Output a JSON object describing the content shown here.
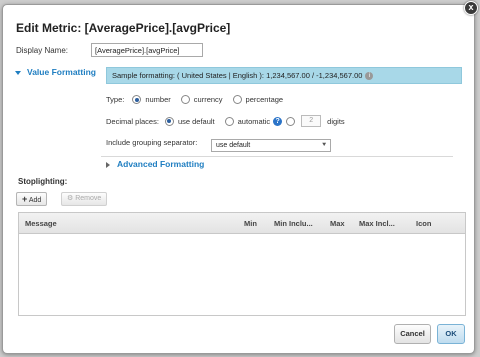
{
  "dialog": {
    "title": "Edit Metric: [AveragePrice].[avgPrice]",
    "close_label": "x",
    "display_name_label": "Display Name:",
    "display_name_value": "[AveragePrice].[avgPrice]"
  },
  "value_formatting": {
    "section_label": "Value Formatting",
    "sample_text": "Sample formatting: ( United States | English ): 1,234,567.00 / -1,234,567.00",
    "info_glyph": "i",
    "type_label": "Type:",
    "type_options": [
      "number",
      "currency",
      "percentage"
    ],
    "type_selected": "number",
    "decimal_label": "Decimal places:",
    "decimal_options": [
      "use default",
      "automatic"
    ],
    "decimal_selected": "use default",
    "help_glyph": "?",
    "digits_value": "2",
    "digits_label": "digits",
    "grouping_label": "Include grouping separator:",
    "grouping_value": "use default",
    "grouping_chevron": "⯆",
    "advanced_label": "Advanced Formatting"
  },
  "stoplighting": {
    "label": "Stoplighting:",
    "add_label": "Add",
    "remove_label": "Remove",
    "columns": [
      "Message",
      "Min",
      "Min Inclu...",
      "Max",
      "Max Incl...",
      "Icon"
    ],
    "rows": []
  },
  "footer": {
    "cancel_label": "Cancel",
    "ok_label": "OK"
  },
  "colors": {
    "accent": "#1f7ec1",
    "sample_bg": "#a8d8e8",
    "ok_bg": "#bfdcef"
  }
}
